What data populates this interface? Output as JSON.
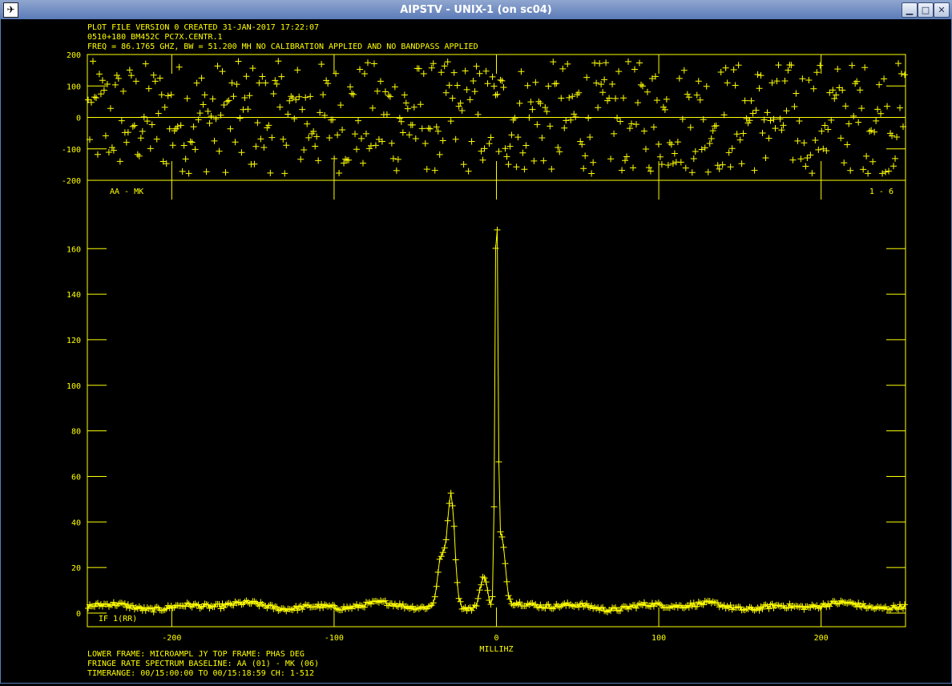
{
  "window": {
    "title": "AIPSTV - UNIX-1 (on sc04)",
    "icon": "aips-icon",
    "buttons": [
      "minimize-icon",
      "maximize-icon",
      "close-icon"
    ]
  },
  "header": {
    "line1": "PLOT FILE VERSION 0  CREATED 31-JAN-2017 17:22:07",
    "line2": "0510+180    BM452C PC7X.CENTR.1",
    "line3": "FREQ = 86.1765 GHZ, BW = 51.200 MH   NO CALIBRATION APPLIED AND NO BANDPASS APPLIED"
  },
  "footer": {
    "line1": "LOWER FRAME: MICROAMPL JY   TOP FRAME: PHAS DEG",
    "line2": "FRINGE RATE SPECTRUM    BASELINE: AA (01) - MK (06)",
    "line3": "TIMERANGE: 00/15:00:00 TO 00/15:18:59 CH: 1-512"
  },
  "colors": {
    "plot": "#ffff00",
    "background": "#000000"
  },
  "chart_data": [
    {
      "type": "scatter",
      "panel": "top",
      "ylabel": "PHAS DEG",
      "ylim": [
        -200,
        200
      ],
      "xlim": [
        -252,
        252
      ],
      "yticks": [
        200,
        100,
        0,
        -100,
        -200
      ],
      "tick_labels": [
        "200",
        "100",
        "0",
        "-100",
        "-200"
      ],
      "series": [
        {
          "marker": "+",
          "description": "random phase scatter",
          "n_points": 512
        }
      ]
    },
    {
      "type": "line",
      "panel": "bottom",
      "xlabel": "MILLIHZ",
      "ylim": [
        -6,
        190
      ],
      "xlim": [
        -252,
        252
      ],
      "yticks": [
        0,
        20,
        40,
        60,
        80,
        100,
        120,
        140,
        160
      ],
      "ytick_labels": [
        "0",
        "20",
        "40",
        "60",
        "80",
        "100",
        "120",
        "140",
        "160"
      ],
      "xticks": [
        -200,
        -100,
        0,
        100,
        200
      ],
      "xtick_labels": [
        "-200",
        "-100",
        "0",
        "100",
        "200"
      ],
      "label_left": "AA - MK",
      "label_right": "1 - 6",
      "label_bottom_left": "IF 1(RR)",
      "baseline_level": 3,
      "peaks": [
        {
          "x": -28,
          "y": 49
        },
        {
          "x": -34,
          "y": 21
        },
        {
          "x": -8,
          "y": 14
        },
        {
          "x": 0,
          "y": 176
        },
        {
          "x": 3,
          "y": 30
        }
      ]
    }
  ]
}
